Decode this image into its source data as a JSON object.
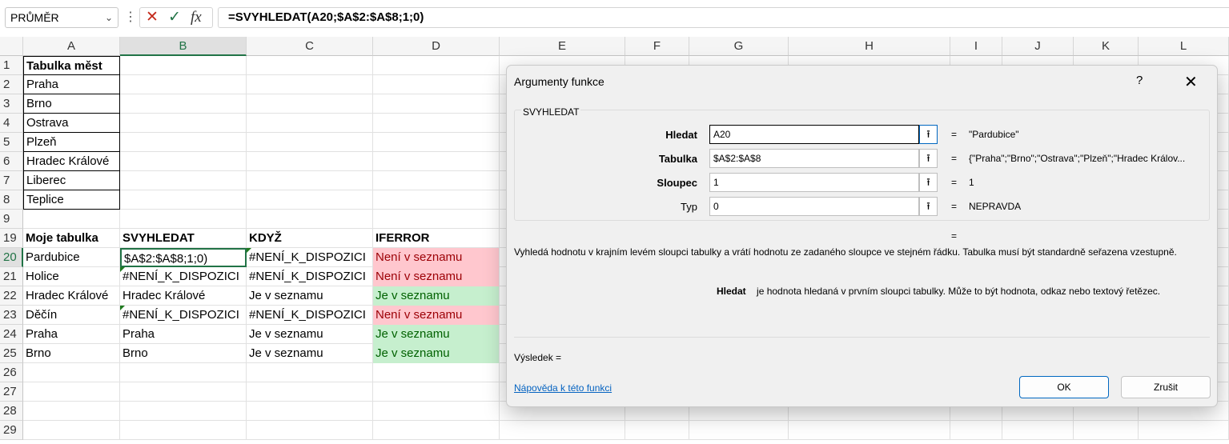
{
  "formula_bar": {
    "name_box": "PRŮMĚR",
    "cancel_glyph": "✕",
    "enter_glyph": "✓",
    "fx_glyph": "fx",
    "formula": "=SVYHLEDAT(A20;$A$2:$A$8;1;0)"
  },
  "columns": [
    "A",
    "B",
    "C",
    "D",
    "E",
    "F",
    "G",
    "H",
    "I",
    "J",
    "K",
    "L"
  ],
  "rows": [
    "1",
    "2",
    "3",
    "4",
    "5",
    "6",
    "7",
    "8",
    "9",
    "19",
    "20",
    "21",
    "22",
    "23",
    "24",
    "25",
    "26",
    "27",
    "28",
    "29"
  ],
  "cells": {
    "A1": "Tabulka měst",
    "A2": "Praha",
    "A3": "Brno",
    "A4": "Ostrava",
    "A5": "Plzeň",
    "A6": "Hradec Králové",
    "A7": "Liberec",
    "A8": "Teplice",
    "A19": "Moje tabulka",
    "B19": "SVYHLEDAT",
    "C19": "KDYŽ",
    "D19": "IFERROR",
    "A20": "Pardubice",
    "B20": "$A$2:$A$8;1;0)",
    "C20": "#NENÍ_K_DISPOZICI",
    "D20": "Není v seznamu",
    "A21": "Holice",
    "B21": "#NENÍ_K_DISPOZICI",
    "C21": "#NENÍ_K_DISPOZICI",
    "D21": "Není v seznamu",
    "A22": "Hradec Králové",
    "B22": "Hradec Králové",
    "C22": "Je v seznamu",
    "D22": "Je v seznamu",
    "A23": "Děčín",
    "B23": "#NENÍ_K_DISPOZICI",
    "C23": "#NENÍ_K_DISPOZICI",
    "D23": "Není v seznamu",
    "A24": "Praha",
    "B24": "Praha",
    "C24": "Je v seznamu",
    "D24": "Je v seznamu",
    "A25": "Brno",
    "B25": "Brno",
    "C25": "Je v seznamu",
    "D25": "Je v seznamu"
  },
  "dialog": {
    "title": "Argumenty funkce",
    "help_glyph": "?",
    "close_glyph": "✕",
    "function_name": "SVYHLEDAT",
    "arguments": [
      {
        "label": "Hledat",
        "value": "A20",
        "result": "\"Pardubice\""
      },
      {
        "label": "Tabulka",
        "value": "$A$2:$A$8",
        "result": "{\"Praha\";\"Brno\";\"Ostrava\";\"Plzeň\";\"Hradec Králov..."
      },
      {
        "label": "Sloupec",
        "value": "1",
        "result": "1"
      },
      {
        "label": "Typ",
        "value": "0",
        "result": "NEPRAVDA"
      }
    ],
    "ref_glyph": "⭱",
    "equals": "=",
    "description": "Vyhledá hodnotu v krajním levém sloupci tabulky a vrátí hodnotu ze zadaného sloupce ve stejném řádku. Tabulka musí být standardně seřazena vzestupně.",
    "arg_name": "Hledat",
    "arg_description": "je hodnota hledaná v prvním sloupci tabulky. Může to být hodnota, odkaz nebo textový řetězec.",
    "result_label": "Výsledek =",
    "help_link": "Nápověda k této funkci",
    "ok_label": "OK",
    "cancel_label": "Zrušit"
  },
  "colors": {
    "accent": "#217346",
    "bad_fill": "#ffc7ce",
    "bad_text": "#9c0006",
    "good_fill": "#c6efce",
    "good_text": "#006100",
    "link": "#0563c1",
    "button_focus": "#0067c0"
  }
}
